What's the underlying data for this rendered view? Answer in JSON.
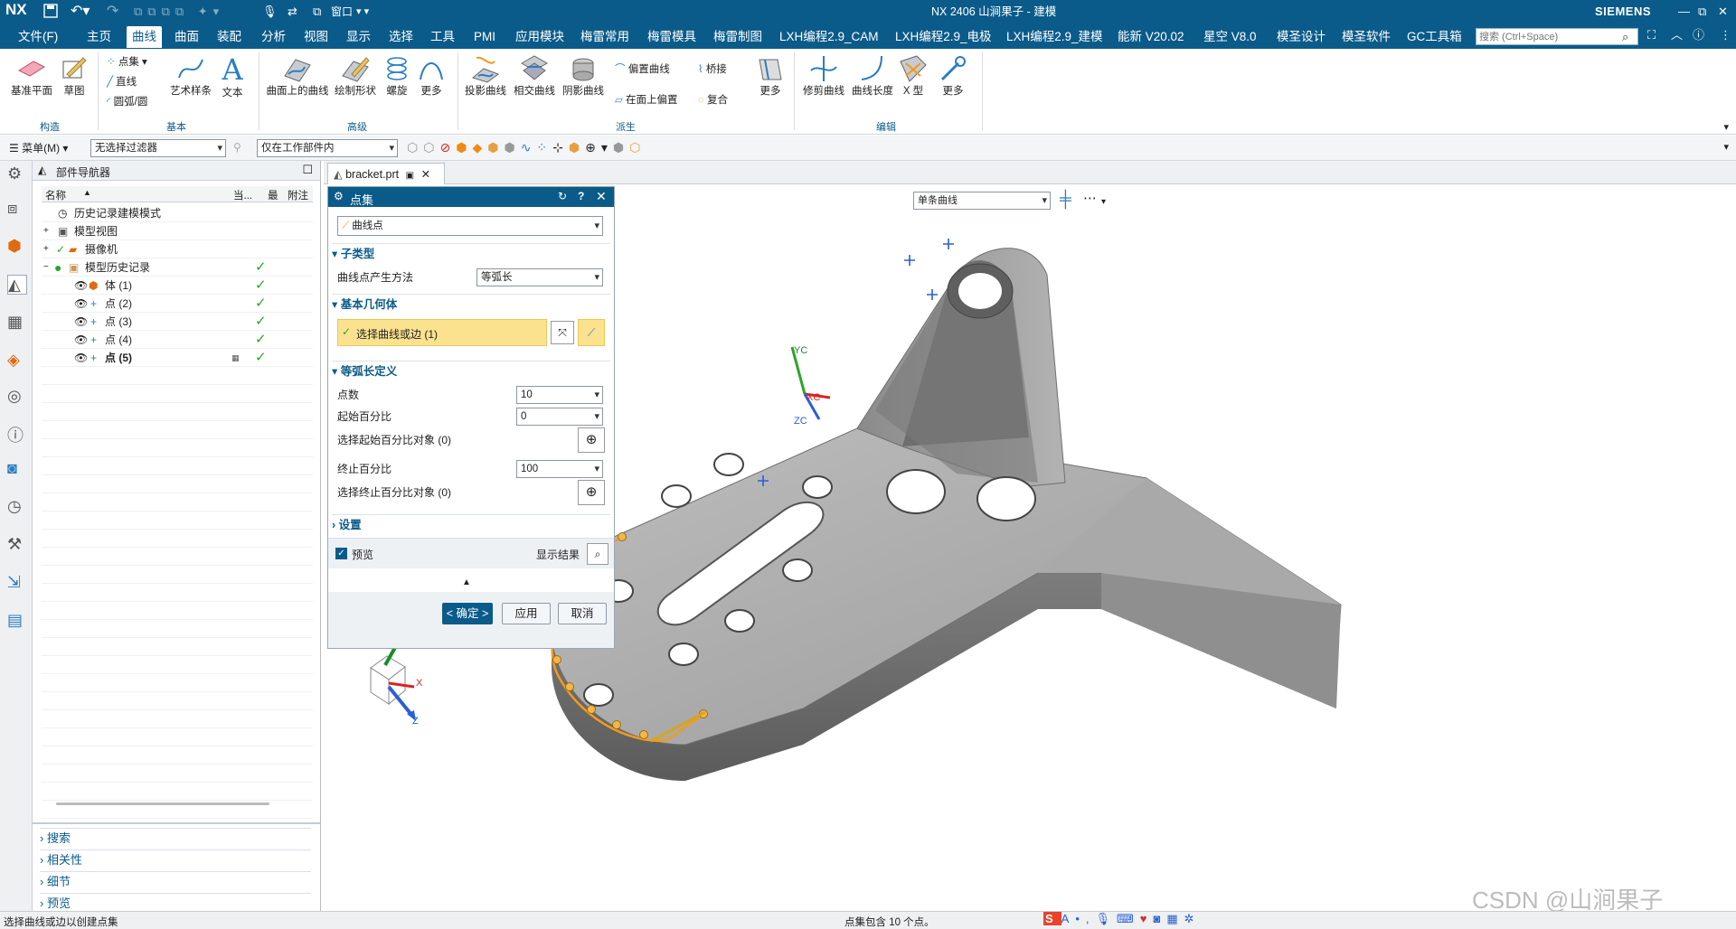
{
  "title_bar": {
    "logo": "NX",
    "title": "NX 2406 山涧果子 - 建模",
    "brand": "SIEMENS",
    "window_menu": "窗口"
  },
  "menu": {
    "file": "文件(F)",
    "tabs": [
      "主页",
      "曲线",
      "曲面",
      "装配",
      "分析",
      "视图",
      "显示",
      "选择",
      "工具",
      "PMI",
      "应用模块",
      "梅雷常用",
      "梅雷模具",
      "梅雷制图",
      "LXH编程2.9_CAM",
      "LXH编程2.9_电极",
      "LXH编程2.9_建模",
      "能新 V20.02",
      "星空 V8.0",
      "模圣设计",
      "模圣软件",
      "GC工具箱"
    ],
    "active_tab": "曲线",
    "search_placeholder": "搜索 (Ctrl+Space)"
  },
  "ribbon": {
    "construct": {
      "datum_plane": "基准平面",
      "sketch": "草图",
      "group": "构造"
    },
    "basic": {
      "point_set": "点集",
      "line": "直线",
      "arc": "圆弧/圆",
      "art_spline": "艺术样条",
      "text": "文本",
      "group": "基本"
    },
    "advanced": {
      "curve_on_surface": "曲面上的曲线",
      "draw_shape": "绘制形状",
      "helix": "螺旋",
      "more": "更多",
      "group": "高级"
    },
    "derived": {
      "project": "投影曲线",
      "intersect": "相交曲线",
      "isoparametric": "阴影曲线",
      "offset": "偏置曲线",
      "offset_on_face": "在面上偏置",
      "bridge": "桥接",
      "composite": "复合",
      "more": "更多",
      "group": "派生"
    },
    "edit": {
      "trim": "修剪曲线",
      "length": "曲线长度",
      "x_form": "X 型",
      "more": "更多",
      "group": "编辑"
    }
  },
  "selection_bar": {
    "menu": "菜单(M)",
    "filter": "无选择过滤器",
    "scope": "仅在工作部件内"
  },
  "navigator": {
    "title": "部件导航器",
    "columns": [
      "名称",
      "当...",
      "最",
      "附注"
    ],
    "rows": [
      {
        "label": "历史记录建模模式",
        "indent": 0,
        "check": false
      },
      {
        "label": "模型视图",
        "indent": 0,
        "check": false
      },
      {
        "label": "摄像机",
        "indent": 0,
        "check": false
      },
      {
        "label": "模型历史记录",
        "indent": 0,
        "check": true
      },
      {
        "label": "体 (1)",
        "indent": 1,
        "check": true
      },
      {
        "label": "点 (2)",
        "indent": 1,
        "check": true
      },
      {
        "label": "点 (3)",
        "indent": 1,
        "check": true
      },
      {
        "label": "点 (4)",
        "indent": 1,
        "check": true
      },
      {
        "label": "点 (5)",
        "indent": 1,
        "check": true,
        "bold": true
      }
    ],
    "bottom_sections": [
      "搜索",
      "相关性",
      "细节",
      "预览"
    ]
  },
  "doc_tab": {
    "name": "bracket.prt"
  },
  "dialog": {
    "title": "点集",
    "type_value": "曲线点",
    "subtype_section": "子类型",
    "method_label": "曲线点产生方法",
    "method_value": "等弧长",
    "geometry_section": "基本几何体",
    "select_curve": "选择曲线或边 (1)",
    "arc_section": "等弧长定义",
    "num_points_label": "点数",
    "num_points_value": "10",
    "start_pct_label": "起始百分比",
    "start_pct_value": "0",
    "select_start_obj": "选择起始百分比对象 (0)",
    "end_pct_label": "终止百分比",
    "end_pct_value": "100",
    "select_end_obj": "选择终止百分比对象 (0)",
    "settings_section": "设置",
    "preview_label": "预览",
    "show_result": "显示结果",
    "ok": "< 确定 >",
    "apply": "应用",
    "cancel": "取消"
  },
  "viewport": {
    "curve_rule": "单条曲线",
    "wcs": {
      "x": "XC",
      "y": "YC",
      "z": "ZC"
    },
    "triad": {
      "x": "X",
      "y": "Y",
      "z": "Z"
    }
  },
  "status": {
    "left": "选择曲线或边以创建点集",
    "center": "点集包含 10 个点。",
    "watermark": "CSDN @山涧果子"
  },
  "colors": {
    "accent": "#0b5b8a",
    "highlight": "#fbe28f",
    "curve": "#f39a1f",
    "model": "#9a9a9a"
  }
}
